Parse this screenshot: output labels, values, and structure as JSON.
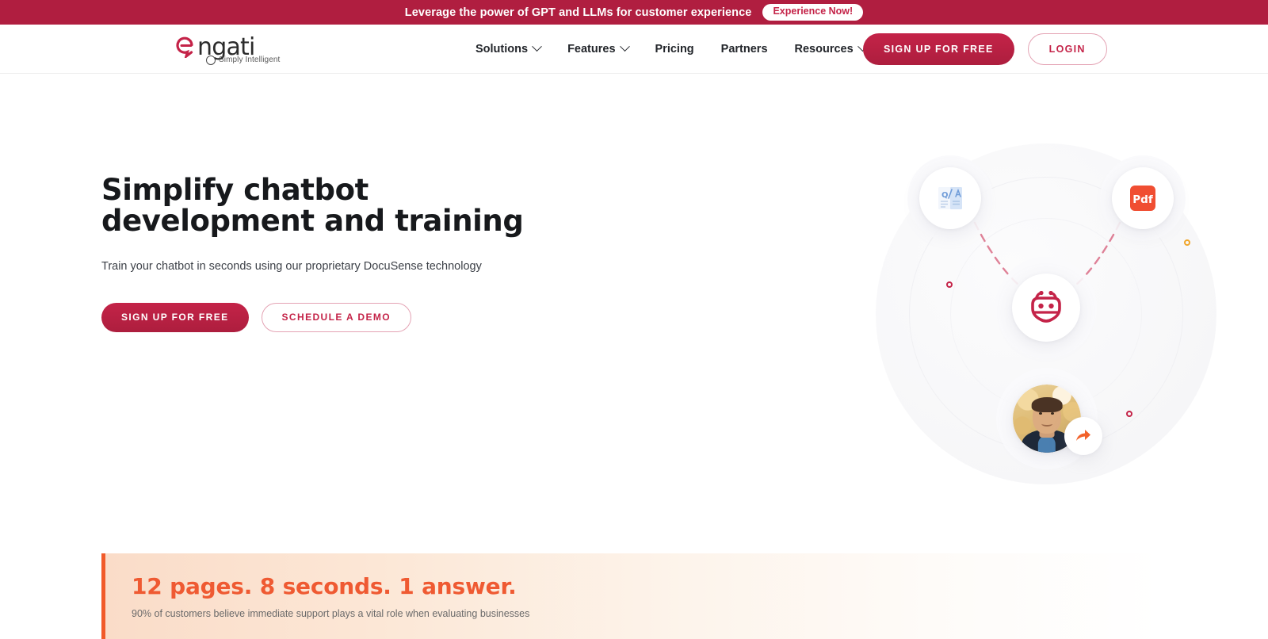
{
  "promo": {
    "text": "Leverage the power of GPT and LLMs for customer experience",
    "button_label": "Experience Now!",
    "background_color": "#B01E40"
  },
  "header": {
    "logo": {
      "wordmark": "ngati",
      "tagline": "Simply Intelligent",
      "icon": "engati-e-icon"
    },
    "nav": [
      {
        "label": "Solutions",
        "has_dropdown": true
      },
      {
        "label": "Features",
        "has_dropdown": true
      },
      {
        "label": "Pricing",
        "has_dropdown": false
      },
      {
        "label": "Partners",
        "has_dropdown": false
      },
      {
        "label": "Resources",
        "has_dropdown": true
      }
    ],
    "signup_label": "SIGN UP FOR FREE",
    "login_label": "LOGIN",
    "brand_color": "#C42348"
  },
  "hero": {
    "title": "Simplify chatbot development and training",
    "subtitle": "Train your chatbot in seconds using our proprietary DocuSense technology",
    "primary_cta": "SIGN UP FOR FREE",
    "secondary_cta": "SCHEDULE A DEMO",
    "illustration": {
      "nodes": [
        {
          "name": "qa-document-icon",
          "label": "Q/A"
        },
        {
          "name": "pdf-file-icon",
          "label": "Pdf"
        },
        {
          "name": "chatbot-icon",
          "label": ""
        },
        {
          "name": "user-avatar",
          "label": ""
        },
        {
          "name": "share-icon",
          "label": ""
        }
      ],
      "accent_colors": [
        "#C42348",
        "#F0A52A",
        "#F15A29",
        "#4A7FB0"
      ]
    }
  },
  "stat_banner": {
    "headline": "12 pages. 8 seconds. 1 answer.",
    "subtext": "90% of customers believe immediate support plays a vital role when evaluating businesses",
    "accent_color": "#F15A29"
  }
}
